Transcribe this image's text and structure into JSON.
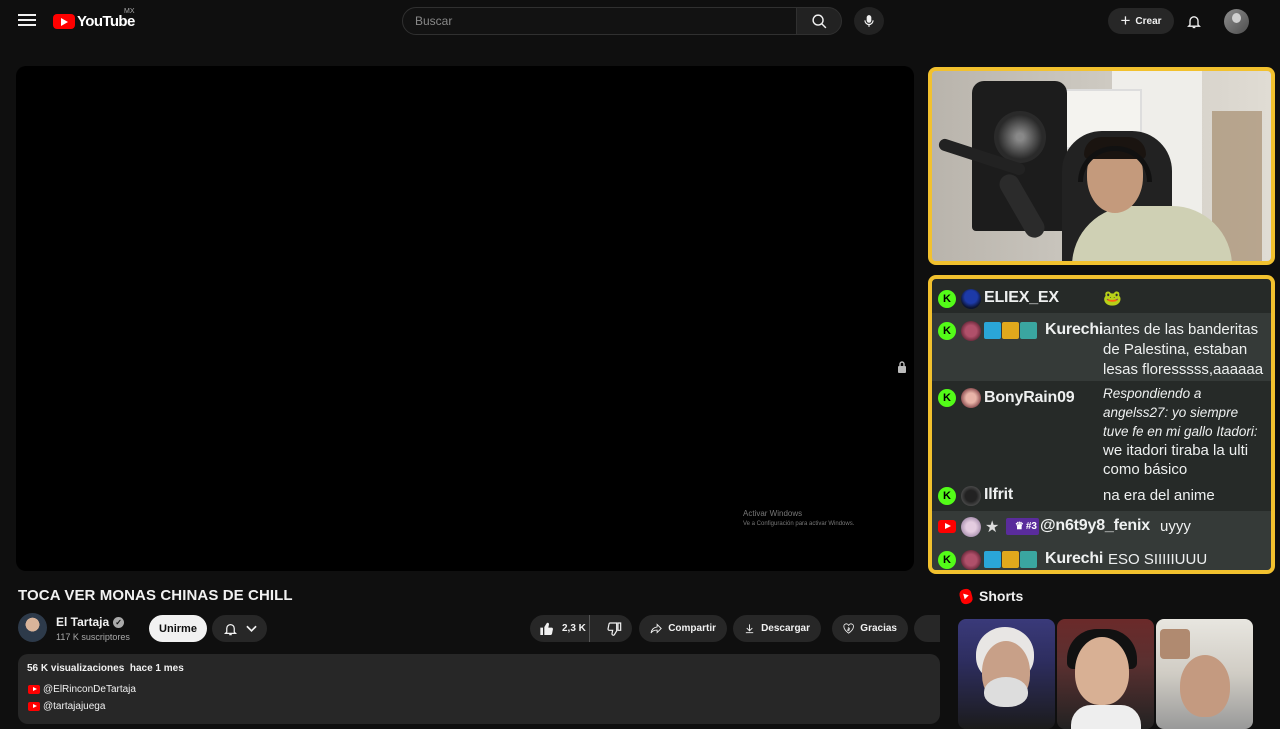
{
  "header": {
    "logo_text": "YouTube",
    "country_code": "MX",
    "search_placeholder": "Buscar",
    "create_label": "Crear"
  },
  "video": {
    "watermark_line1": "Activar Windows",
    "watermark_line2": "Ve a Configuración para activar Windows."
  },
  "chat": {
    "messages": [
      {
        "platform": "kick",
        "user": "ELIEX_EX",
        "text": "🐸"
      },
      {
        "platform": "kick",
        "user": "Kurechi",
        "text": "antes de las banderitas de Palestina, estaban lesas floresssss,aaaaaa"
      },
      {
        "platform": "kick",
        "user": "BonyRain09",
        "reply": "Respondiendo a angelss27: yo siempre tuve fe en mi gallo Itadori:",
        "text": "we itadori tiraba la ulti como básico"
      },
      {
        "platform": "kick",
        "user": "Ilfrit",
        "text": "na era del anime"
      },
      {
        "platform": "youtube",
        "user": "@n6t9y8_fenix",
        "badge_text": "#3",
        "text": "uyyy"
      },
      {
        "platform": "kick",
        "user": "Kurechi",
        "text": "ESO SIIIIIUUU"
      }
    ]
  },
  "video_info": {
    "title": "TOCA VER MONAS CHINAS DE CHILL",
    "channel_name": "El Tartaja",
    "verified_mark": "✓",
    "subscribers": "117 K suscriptores",
    "join_label": "Unirme",
    "likes": "2,3 K",
    "share_label": "Compartir",
    "download_label": "Descargar",
    "thanks_label": "Gracias"
  },
  "description": {
    "views": "56 K visualizaciones",
    "date": "hace 1 mes",
    "links": [
      "@ElRinconDeTartaja",
      "@tartajajuega"
    ]
  },
  "shorts": {
    "heading": "Shorts"
  },
  "colors": {
    "accent_red": "#ff0000",
    "overlay_border": "#f2c12e",
    "kick_green": "#53fc18",
    "background": "#0f0f0f"
  }
}
